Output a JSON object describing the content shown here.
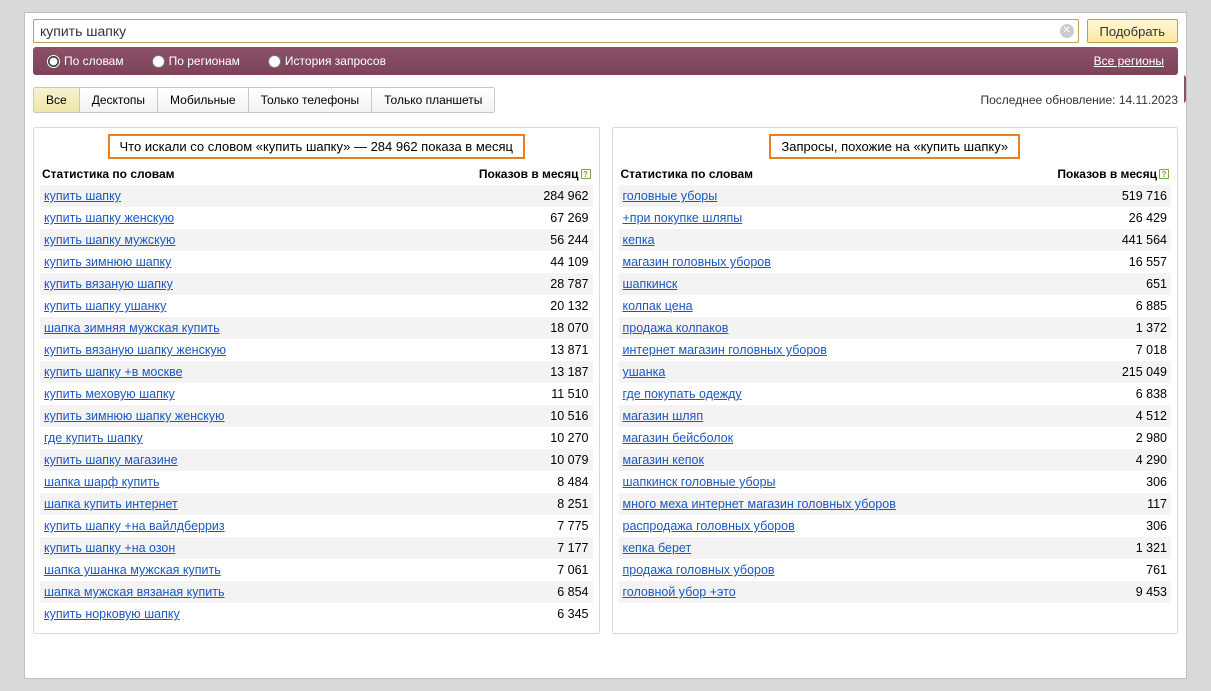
{
  "search": {
    "value": "купить шапку",
    "button": "Подобрать",
    "clear_icon": "✕"
  },
  "modes": {
    "by_words": "По словам",
    "by_regions": "По регионам",
    "history": "История запросов",
    "selected": "by_words"
  },
  "region_link": "Все регионы",
  "device_tabs": [
    "Все",
    "Десктопы",
    "Мобильные",
    "Только телефоны",
    "Только планшеты"
  ],
  "device_selected": 0,
  "last_update_label": "Последнее обновление:",
  "last_update_value": "14.11.2023",
  "columns": {
    "stats_header": "Статистика по словам",
    "count_header": "Показов в месяц",
    "help_glyph": "?"
  },
  "left": {
    "title": "Что искали со словом «купить шапку» — 284 962 показа в месяц",
    "rows": [
      {
        "kw": "купить шапку",
        "cnt": "284 962"
      },
      {
        "kw": "купить шапку женскую",
        "cnt": "67 269"
      },
      {
        "kw": "купить шапку мужскую",
        "cnt": "56 244"
      },
      {
        "kw": "купить зимнюю шапку",
        "cnt": "44 109"
      },
      {
        "kw": "купить вязаную шапку",
        "cnt": "28 787"
      },
      {
        "kw": "купить шапку ушанку",
        "cnt": "20 132"
      },
      {
        "kw": "шапка зимняя мужская купить",
        "cnt": "18 070"
      },
      {
        "kw": "купить вязаную шапку женскую",
        "cnt": "13 871"
      },
      {
        "kw": "купить шапку +в москве",
        "cnt": "13 187"
      },
      {
        "kw": "купить меховую шапку",
        "cnt": "11 510"
      },
      {
        "kw": "купить зимнюю шапку женскую",
        "cnt": "10 516"
      },
      {
        "kw": "где купить шапку",
        "cnt": "10 270"
      },
      {
        "kw": "купить шапку магазине",
        "cnt": "10 079"
      },
      {
        "kw": "шапка шарф купить",
        "cnt": "8 484"
      },
      {
        "kw": "шапка купить интернет",
        "cnt": "8 251"
      },
      {
        "kw": "купить шапку +на вайлдберриз",
        "cnt": "7 775"
      },
      {
        "kw": "купить шапку +на озон",
        "cnt": "7 177"
      },
      {
        "kw": "шапка ушанка мужская купить",
        "cnt": "7 061"
      },
      {
        "kw": "шапка мужская вязаная купить",
        "cnt": "6 854"
      },
      {
        "kw": "купить норковую шапку",
        "cnt": "6 345"
      }
    ]
  },
  "right": {
    "title": "Запросы, похожие на «купить шапку»",
    "rows": [
      {
        "kw": "головные уборы",
        "cnt": "519 716"
      },
      {
        "kw": "+при покупке шляпы",
        "cnt": "26 429"
      },
      {
        "kw": "кепка",
        "cnt": "441 564"
      },
      {
        "kw": "магазин головных уборов",
        "cnt": "16 557"
      },
      {
        "kw": "шапкинск",
        "cnt": "651"
      },
      {
        "kw": "колпак цена",
        "cnt": "6 885"
      },
      {
        "kw": "продажа колпаков",
        "cnt": "1 372"
      },
      {
        "kw": "интернет магазин головных уборов",
        "cnt": "7 018"
      },
      {
        "kw": "ушанка",
        "cnt": "215 049"
      },
      {
        "kw": "где покупать одежду",
        "cnt": "6 838"
      },
      {
        "kw": "магазин шляп",
        "cnt": "4 512"
      },
      {
        "kw": "магазин бейсболок",
        "cnt": "2 980"
      },
      {
        "kw": "магазин кепок",
        "cnt": "4 290"
      },
      {
        "kw": "шапкинск головные уборы",
        "cnt": "306"
      },
      {
        "kw": "много меха интернет магазин головных уборов",
        "cnt": "117"
      },
      {
        "kw": "распродажа головных уборов",
        "cnt": "306"
      },
      {
        "kw": "кепка берет",
        "cnt": "1 321"
      },
      {
        "kw": "продажа головных уборов",
        "cnt": "761"
      },
      {
        "kw": "головной убор +это",
        "cnt": "9 453"
      }
    ]
  }
}
